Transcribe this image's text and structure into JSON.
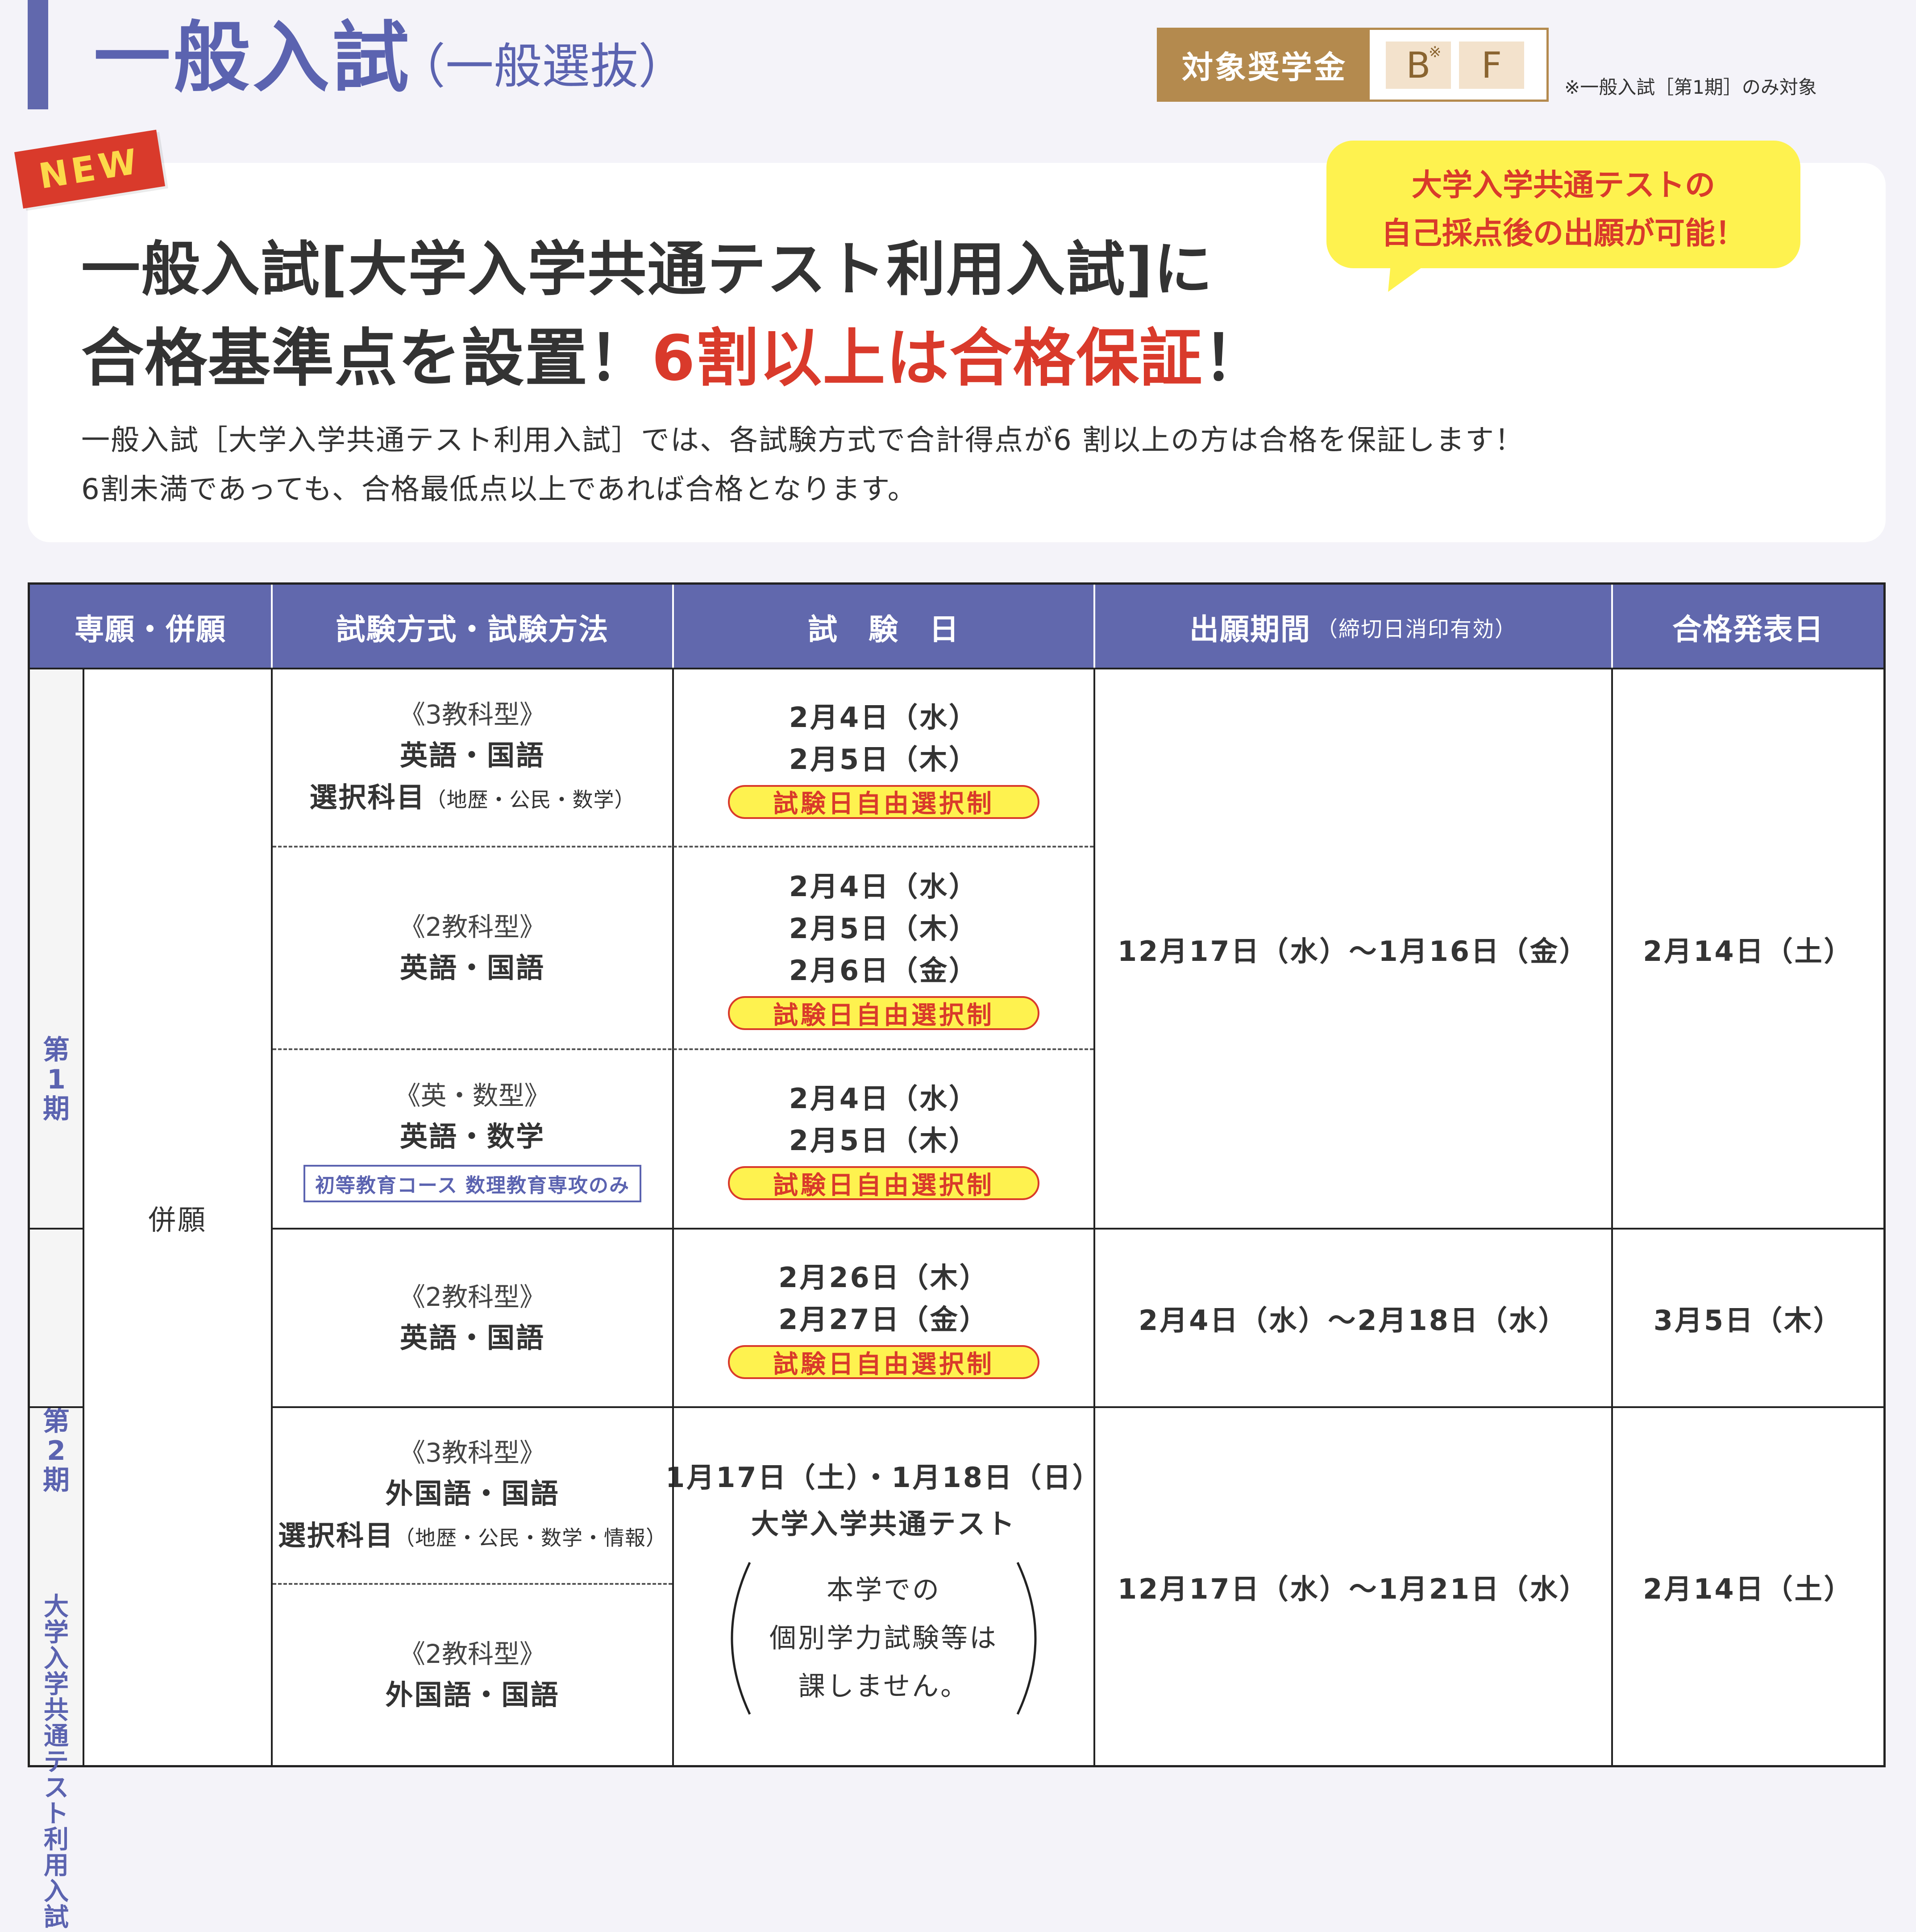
{
  "header": {
    "title": "一般入試",
    "subtitle": "（一般選抜）",
    "scholarship_label": "対象奨学金",
    "scholarship_chips": [
      "B",
      "F"
    ],
    "chip_mark": "※",
    "scholarship_note": "※一般入試［第1期］のみ対象"
  },
  "intro": {
    "badge": "NEW",
    "bubble_line1": "大学入学共通テストの",
    "bubble_line2": "自己採点後の出願が可能！",
    "headline_line1": "一般入試[大学入学共通テスト利用入試]に",
    "headline_line2_a": "合格基準点を設置！",
    "headline_line2_b": "6割以上は合格保証",
    "headline_line2_c": "！",
    "text_line1": "一般入試［大学入学共通テスト利用入試］では、各試験方式で合計得点が6 割以上の方は合格を保証します！",
    "text_line2": "6割未満であっても、合格最低点以上であれば合格となります。"
  },
  "table": {
    "headers": {
      "type": "専願・併願",
      "method": "試験方式・試験方法",
      "date": "試　験　日",
      "period": "出願期間",
      "period_note": "（締切日消印有効）",
      "result": "合格発表日"
    },
    "apply_type": "併願",
    "free_select": "試験日自由選択制",
    "periods": [
      "第1期",
      "第2期",
      "大学入学共通テスト利用入試"
    ],
    "first": {
      "methods": [
        {
          "type": "《3教科型》",
          "subj": "英語・国語",
          "subj2": "選択科目",
          "subj2_note": "（地歴・公民・数学）",
          "dates": [
            "2月4日（水）",
            "2月5日（木）"
          ]
        },
        {
          "type": "《2教科型》",
          "subj": "英語・国語",
          "dates": [
            "2月4日（水）",
            "2月5日（木）",
            "2月6日（金）"
          ]
        },
        {
          "type": "《英・数型》",
          "subj": "英語・数学",
          "note": "初等教育コース 数理教育専攻のみ",
          "dates": [
            "2月4日（水）",
            "2月5日（木）"
          ]
        }
      ],
      "application": "12月17日（水）〜1月16日（金）",
      "result": "2月14日（土）"
    },
    "second": {
      "type": "《2教科型》",
      "subj": "英語・国語",
      "dates": [
        "2月26日（木）",
        "2月27日（金）"
      ],
      "application": "2月4日（水）〜2月18日（水）",
      "result": "3月5日（木）"
    },
    "common": {
      "methods": [
        {
          "type": "《3教科型》",
          "subj": "外国語・国語",
          "subj2": "選択科目",
          "subj2_note": "（地歴・公民・数学・情報）"
        },
        {
          "type": "《2教科型》",
          "subj": "外国語・国語"
        }
      ],
      "date": "1月17日（土）・1月18日（日）",
      "date_label": "大学入学共通テスト",
      "note_lines": [
        "本学での",
        "個別学力試験等は",
        "課しません。"
      ],
      "application": "12月17日（水）〜1月21日（水）",
      "result": "2月14日（土）"
    }
  },
  "colors": {
    "accent": "#6168ad",
    "red": "#d93a2b",
    "yellow": "#fef24f",
    "gold": "#b48a4e"
  }
}
